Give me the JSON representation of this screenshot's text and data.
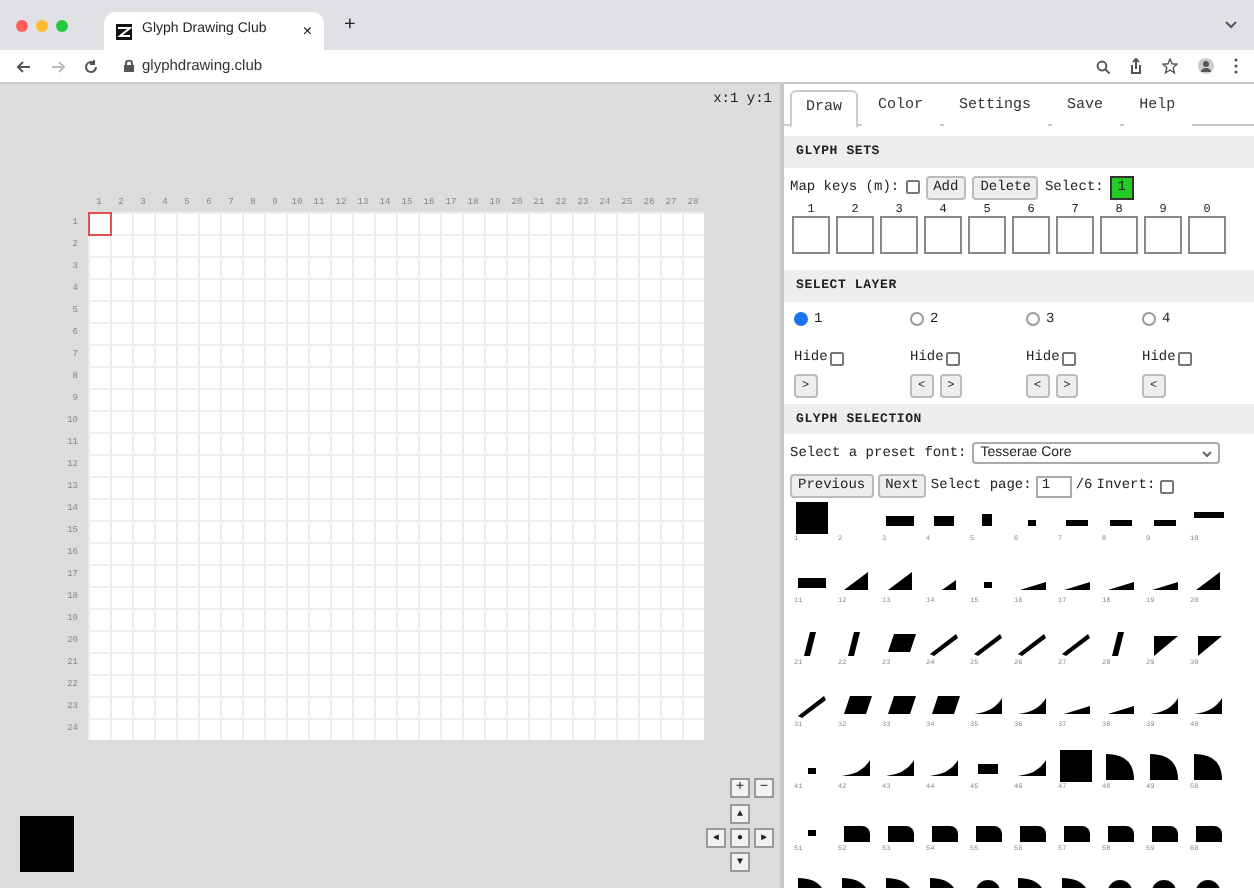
{
  "browser": {
    "tab_title": "Glyph Drawing Club",
    "tab_close": "×",
    "new_tab": "+",
    "url": "glyphdrawing.club"
  },
  "canvas": {
    "coords": "x:1 y:1",
    "column_labels": [
      "1",
      "2",
      "3",
      "4",
      "5",
      "6",
      "7",
      "8",
      "9",
      "10",
      "11",
      "12",
      "13",
      "14",
      "15",
      "16",
      "17",
      "18",
      "19",
      "20",
      "21",
      "22",
      "23",
      "24",
      "25",
      "26",
      "27",
      "28"
    ],
    "row_labels": [
      "1",
      "2",
      "3",
      "4",
      "5",
      "6",
      "7",
      "8",
      "9",
      "10",
      "11",
      "12",
      "13",
      "14",
      "15",
      "16",
      "17",
      "18",
      "19",
      "20",
      "21",
      "22",
      "23",
      "24"
    ]
  },
  "zoom_buttons": [
    "+",
    "−"
  ],
  "pan_buttons": [
    "▲",
    "◄",
    "●",
    "►",
    "▼"
  ],
  "tabs": [
    {
      "label": "Draw",
      "selected": true
    },
    {
      "label": "Color",
      "selected": false
    },
    {
      "label": "Settings",
      "selected": false
    },
    {
      "label": "Save",
      "selected": false
    },
    {
      "label": "Help",
      "selected": false
    }
  ],
  "glyph_sets": {
    "heading": "GLYPH SETS",
    "map_keys_label": "Map keys (m):",
    "map_keys_checked": false,
    "buttons": [
      "Add",
      "Delete"
    ],
    "select_label": "Select:",
    "selected_set": "1",
    "slots": [
      "1",
      "2",
      "3",
      "4",
      "5",
      "6",
      "7",
      "8",
      "9",
      "0"
    ]
  },
  "layers": {
    "heading": "SELECT LAYER",
    "items": [
      {
        "label": "1",
        "selected": true,
        "hide_label": "Hide",
        "hidden": false,
        "arrows": [
          ">"
        ]
      },
      {
        "label": "2",
        "selected": false,
        "hide_label": "Hide",
        "hidden": false,
        "arrows": [
          "<",
          ">"
        ]
      },
      {
        "label": "3",
        "selected": false,
        "hide_label": "Hide",
        "hidden": false,
        "arrows": [
          "<",
          ">"
        ]
      },
      {
        "label": "4",
        "selected": false,
        "hide_label": "Hide",
        "hidden": false,
        "arrows": [
          "<"
        ]
      }
    ]
  },
  "glyph_selection": {
    "heading": "GLYPH SELECTION",
    "font_label": "Select a preset font:",
    "font": "Tesserae Core",
    "buttons": [
      "Previous",
      "Next"
    ],
    "page_label": "Select page:",
    "page": "1",
    "page_total": "/6",
    "invert_label": "Invert:",
    "invert": false,
    "glyphs": [
      {
        "label": "1",
        "kind": "block"
      },
      {
        "label": "2",
        "kind": "blank"
      },
      {
        "label": "3",
        "kind": "widebar"
      },
      {
        "label": "4",
        "kind": "bar"
      },
      {
        "label": "5",
        "kind": "smallbar"
      },
      {
        "label": "6",
        "kind": "dot"
      },
      {
        "label": "7",
        "kind": "thinbar"
      },
      {
        "label": "8",
        "kind": "thinbar"
      },
      {
        "label": "9",
        "kind": "thinbar"
      },
      {
        "label": "10",
        "kind": "topbar"
      },
      {
        "label": "11",
        "kind": "widebar"
      },
      {
        "label": "12",
        "kind": "wedge"
      },
      {
        "label": "13",
        "kind": "wedge"
      },
      {
        "label": "14",
        "kind": "smallwedge"
      },
      {
        "label": "15",
        "kind": "dot"
      },
      {
        "label": "16",
        "kind": "slope"
      },
      {
        "label": "17",
        "kind": "slope"
      },
      {
        "label": "18",
        "kind": "slope"
      },
      {
        "label": "19",
        "kind": "slope"
      },
      {
        "label": "20",
        "kind": "wedge"
      },
      {
        "label": "21",
        "kind": "slant"
      },
      {
        "label": "22",
        "kind": "slant"
      },
      {
        "label": "23",
        "kind": "parallelogram"
      },
      {
        "label": "24",
        "kind": "diagonal"
      },
      {
        "label": "25",
        "kind": "diagonal"
      },
      {
        "label": "26",
        "kind": "diagonal"
      },
      {
        "label": "27",
        "kind": "diagonal"
      },
      {
        "label": "28",
        "kind": "slant"
      },
      {
        "label": "29",
        "kind": "corner"
      },
      {
        "label": "30",
        "kind": "corner"
      },
      {
        "label": "31",
        "kind": "diagonal"
      },
      {
        "label": "32",
        "kind": "parallelogram"
      },
      {
        "label": "33",
        "kind": "parallelogram"
      },
      {
        "label": "34",
        "kind": "parallelogram"
      },
      {
        "label": "35",
        "kind": "curve"
      },
      {
        "label": "36",
        "kind": "curve"
      },
      {
        "label": "37",
        "kind": "slope"
      },
      {
        "label": "38",
        "kind": "slope"
      },
      {
        "label": "39",
        "kind": "curve"
      },
      {
        "label": "40",
        "kind": "curve"
      },
      {
        "label": "41",
        "kind": "dot"
      },
      {
        "label": "42",
        "kind": "curve"
      },
      {
        "label": "43",
        "kind": "curve"
      },
      {
        "label": "44",
        "kind": "curve"
      },
      {
        "label": "45",
        "kind": "bar"
      },
      {
        "label": "46",
        "kind": "curve"
      },
      {
        "label": "47",
        "kind": "block"
      },
      {
        "label": "48",
        "kind": "quarter"
      },
      {
        "label": "49",
        "kind": "quarter"
      },
      {
        "label": "50",
        "kind": "quarter"
      },
      {
        "label": "51",
        "kind": "dot"
      },
      {
        "label": "52",
        "kind": "round"
      },
      {
        "label": "53",
        "kind": "round"
      },
      {
        "label": "54",
        "kind": "round"
      },
      {
        "label": "55",
        "kind": "round"
      },
      {
        "label": "56",
        "kind": "round"
      },
      {
        "label": "57",
        "kind": "round"
      },
      {
        "label": "58",
        "kind": "round"
      },
      {
        "label": "59",
        "kind": "round"
      },
      {
        "label": "60",
        "kind": "round"
      },
      {
        "kind": "quarter"
      },
      {
        "kind": "quarter"
      },
      {
        "kind": "quarter"
      },
      {
        "kind": "quarter"
      },
      {
        "kind": "dome"
      },
      {
        "kind": "quarter"
      },
      {
        "kind": "quarter"
      },
      {
        "kind": "dome"
      },
      {
        "kind": "dome"
      },
      {
        "kind": "dome"
      }
    ]
  }
}
